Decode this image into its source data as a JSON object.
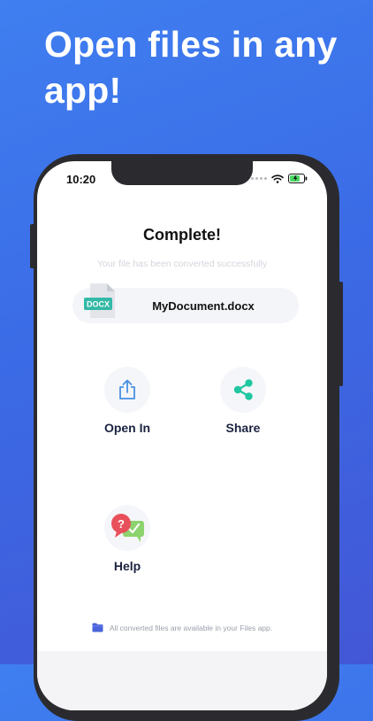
{
  "headline": "Open files in any app!",
  "status_bar": {
    "time": "10:20"
  },
  "screen": {
    "title": "Complete!",
    "subtitle": "Your file has been converted successfully",
    "file": {
      "badge": "DOCX",
      "name": "MyDocument.docx"
    },
    "actions": [
      {
        "label": "Open In",
        "icon": "share-out-icon"
      },
      {
        "label": "Share",
        "icon": "share-nodes-icon"
      },
      {
        "label": "Help",
        "icon": "help-bubbles-icon"
      }
    ],
    "footer_note": "All converted files are available in your Files app."
  },
  "colors": {
    "background_top": "#3f7ff0",
    "background_bottom": "#4357d6",
    "share_accent": "#1fc7a0",
    "open_in_accent": "#4a90e2",
    "docx_badge": "#33b9a6",
    "help_red": "#e8505b",
    "help_green": "#8cd36e",
    "battery_fill": "#4cd964"
  }
}
